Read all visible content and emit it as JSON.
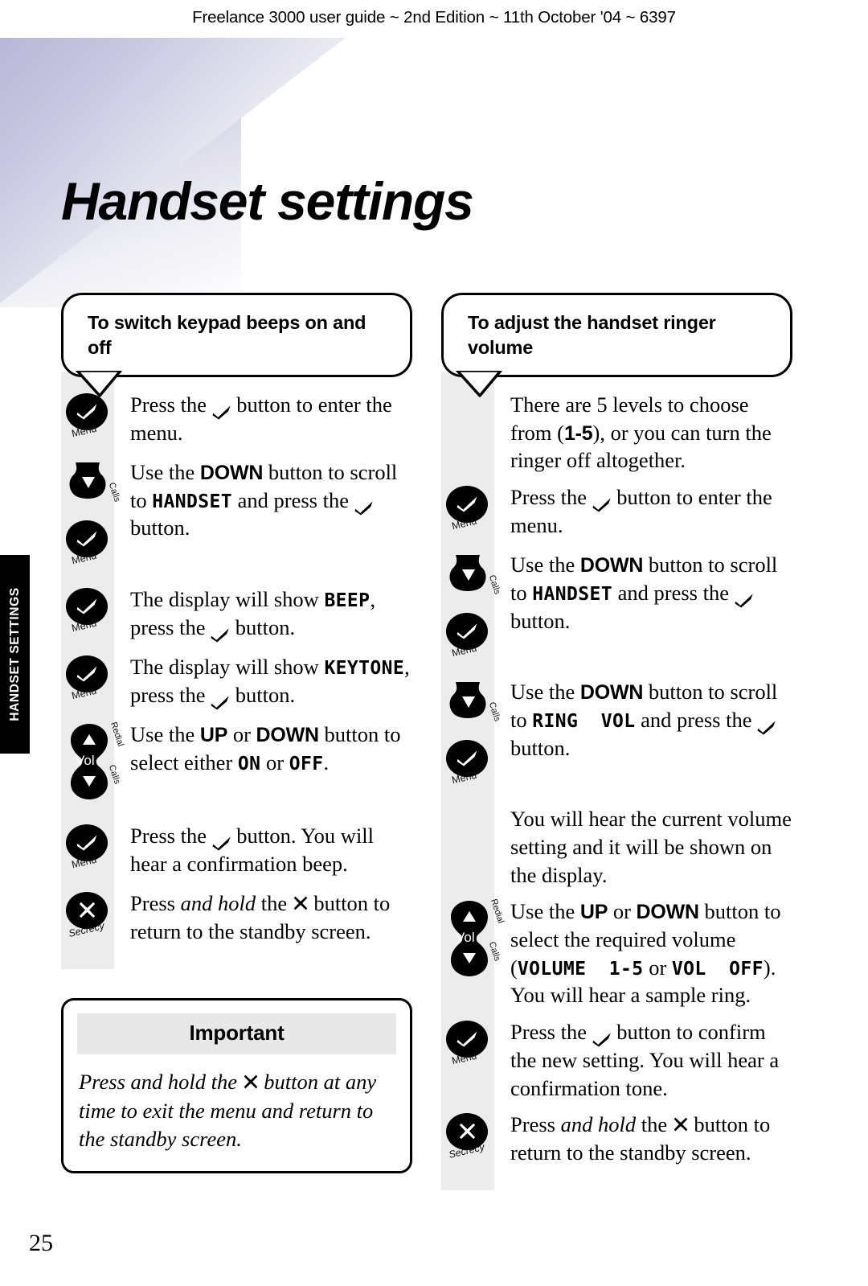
{
  "running_head": "Freelance 3000 user guide ~ 2nd Edition ~ 11th October '04 ~ 6397",
  "page_title": "Handset settings",
  "side_tab": "HANDSET SETTINGS",
  "page_number": "25",
  "keys": {
    "menu": "Menu",
    "calls": "Calls",
    "redial": "Redial",
    "secrecy": "Secrecy",
    "vol": "Vol"
  },
  "columns": [
    {
      "heading": "To switch keypad beeps on and off",
      "steps": [
        {
          "icons": [
            "menu"
          ],
          "text_parts": [
            {
              "t": "plain",
              "v": "Press the "
            },
            {
              "t": "tick"
            },
            {
              "t": "plain",
              "v": " button to enter the menu."
            }
          ]
        },
        {
          "icons": [
            "down",
            "menu"
          ],
          "text_parts": [
            {
              "t": "plain",
              "v": "Use the "
            },
            {
              "t": "kw",
              "v": "DOWN"
            },
            {
              "t": "plain",
              "v": " button to scroll to "
            },
            {
              "t": "lcd",
              "v": "HANDSET"
            },
            {
              "t": "plain",
              "v": " and press the "
            },
            {
              "t": "tick"
            },
            {
              "t": "plain",
              "v": " button."
            }
          ]
        },
        {
          "icons": [
            "menu"
          ],
          "text_parts": [
            {
              "t": "plain",
              "v": "The display will show "
            },
            {
              "t": "lcd",
              "v": "BEEP"
            },
            {
              "t": "plain",
              "v": ", press the "
            },
            {
              "t": "tick"
            },
            {
              "t": "plain",
              "v": " button."
            }
          ]
        },
        {
          "icons": [
            "menu"
          ],
          "text_parts": [
            {
              "t": "plain",
              "v": "The display will show "
            },
            {
              "t": "lcd",
              "v": "KEYTONE"
            },
            {
              "t": "plain",
              "v": ", press the "
            },
            {
              "t": "tick"
            },
            {
              "t": "plain",
              "v": " button."
            }
          ]
        },
        {
          "icons": [
            "volrocker"
          ],
          "text_parts": [
            {
              "t": "plain",
              "v": "Use the "
            },
            {
              "t": "kw",
              "v": "UP"
            },
            {
              "t": "plain",
              "v": " or "
            },
            {
              "t": "kw",
              "v": "DOWN"
            },
            {
              "t": "plain",
              "v": " button to select either "
            },
            {
              "t": "lcd",
              "v": "ON"
            },
            {
              "t": "plain",
              "v": " or "
            },
            {
              "t": "lcd",
              "v": "OFF"
            },
            {
              "t": "plain",
              "v": "."
            }
          ]
        },
        {
          "icons": [
            "menu"
          ],
          "text_parts": [
            {
              "t": "plain",
              "v": "Press the "
            },
            {
              "t": "tick"
            },
            {
              "t": "plain",
              "v": " button. You will hear a confirmation beep."
            }
          ]
        },
        {
          "icons": [
            "secrecy"
          ],
          "text_parts": [
            {
              "t": "plain",
              "v": "Press "
            },
            {
              "t": "it",
              "v": "and hold"
            },
            {
              "t": "plain",
              "v": " the "
            },
            {
              "t": "x"
            },
            {
              "t": "plain",
              "v": " button to return to the standby screen."
            }
          ]
        }
      ],
      "important": {
        "title": "Important",
        "text_parts": [
          {
            "t": "plain",
            "v": "Press and hold the "
          },
          {
            "t": "x"
          },
          {
            "t": "plain",
            "v": " button at any time to exit the menu and return to the standby screen."
          }
        ]
      }
    },
    {
      "heading": "To adjust the handset ringer volume",
      "steps": [
        {
          "icons": [],
          "text_parts": [
            {
              "t": "plain",
              "v": "There are 5 levels to choose from ("
            },
            {
              "t": "kw",
              "v": "1-5"
            },
            {
              "t": "plain",
              "v": "), or you can turn the ringer off altogether."
            }
          ]
        },
        {
          "icons": [
            "menu"
          ],
          "text_parts": [
            {
              "t": "plain",
              "v": "Press the "
            },
            {
              "t": "tick"
            },
            {
              "t": "plain",
              "v": " button to enter the menu."
            }
          ]
        },
        {
          "icons": [
            "down",
            "menu"
          ],
          "text_parts": [
            {
              "t": "plain",
              "v": "Use the "
            },
            {
              "t": "kw",
              "v": "DOWN"
            },
            {
              "t": "plain",
              "v": " button to scroll to "
            },
            {
              "t": "lcd",
              "v": "HANDSET"
            },
            {
              "t": "plain",
              "v": " and press the "
            },
            {
              "t": "tick"
            },
            {
              "t": "plain",
              "v": " button."
            }
          ]
        },
        {
          "icons": [
            "down",
            "menu"
          ],
          "text_parts": [
            {
              "t": "plain",
              "v": "Use the "
            },
            {
              "t": "kw",
              "v": "DOWN"
            },
            {
              "t": "plain",
              "v": " button to scroll to "
            },
            {
              "t": "lcd",
              "v": "RING  VOL"
            },
            {
              "t": "plain",
              "v": " and press the "
            },
            {
              "t": "tick"
            },
            {
              "t": "plain",
              "v": " button."
            }
          ]
        },
        {
          "icons": [],
          "text_parts": [
            {
              "t": "plain",
              "v": "You will hear the current volume setting and it will be shown on the display."
            }
          ]
        },
        {
          "icons": [
            "volrocker"
          ],
          "text_parts": [
            {
              "t": "plain",
              "v": "Use the "
            },
            {
              "t": "kw",
              "v": "UP"
            },
            {
              "t": "plain",
              "v": " or "
            },
            {
              "t": "kw",
              "v": "DOWN"
            },
            {
              "t": "plain",
              "v": " button to select the required volume ("
            },
            {
              "t": "lcd",
              "v": "VOLUME  1-5"
            },
            {
              "t": "plain",
              "v": " or "
            },
            {
              "t": "lcd",
              "v": "VOL  OFF"
            },
            {
              "t": "plain",
              "v": "). You will hear a sample ring."
            }
          ]
        },
        {
          "icons": [
            "menu"
          ],
          "text_parts": [
            {
              "t": "plain",
              "v": "Press the "
            },
            {
              "t": "tick"
            },
            {
              "t": "plain",
              "v": " button to confirm the new setting. You will hear a confirmation tone."
            }
          ]
        },
        {
          "icons": [
            "secrecy"
          ],
          "text_parts": [
            {
              "t": "plain",
              "v": "Press "
            },
            {
              "t": "it",
              "v": "and hold"
            },
            {
              "t": "plain",
              "v": " the "
            },
            {
              "t": "x"
            },
            {
              "t": "plain",
              "v": " button to return to the standby screen."
            }
          ]
        }
      ],
      "important": null
    }
  ]
}
